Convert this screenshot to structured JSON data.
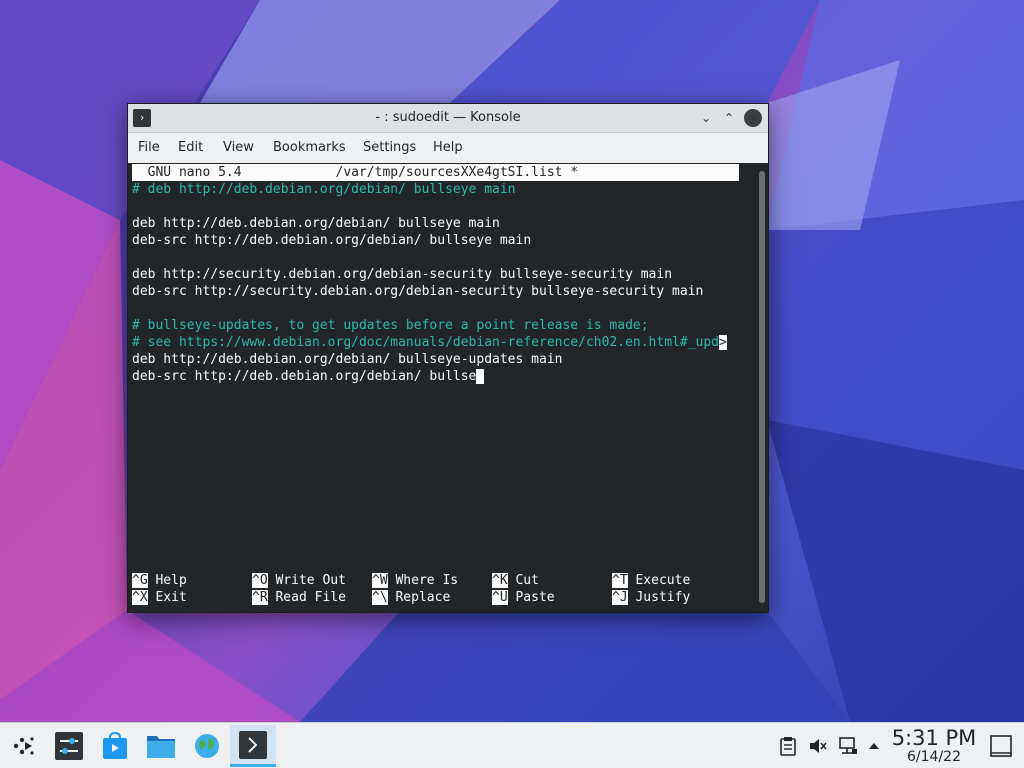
{
  "window": {
    "title": "- : sudoedit — Konsole",
    "minimize_glyph": "⌄",
    "maximize_glyph": "⌃",
    "close_glyph": "✕",
    "app_icon_glyph": "›"
  },
  "menubar": {
    "items": [
      "File",
      "Edit",
      "View",
      "Bookmarks",
      "Settings",
      "Help"
    ]
  },
  "nano": {
    "header": "  GNU nano 5.4            /var/tmp/sourcesXXe4gtSI.list *",
    "lines": [
      {
        "text": "# deb http://deb.debian.org/debian/ bullseye main",
        "kind": "comment"
      },
      {
        "text": "",
        "kind": "plain"
      },
      {
        "text": "deb http://deb.debian.org/debian/ bullseye main",
        "kind": "plain"
      },
      {
        "text": "deb-src http://deb.debian.org/debian/ bullseye main",
        "kind": "plain"
      },
      {
        "text": "",
        "kind": "plain"
      },
      {
        "text": "deb http://security.debian.org/debian-security bullseye-security main",
        "kind": "plain"
      },
      {
        "text": "deb-src http://security.debian.org/debian-security bullseye-security main",
        "kind": "plain"
      },
      {
        "text": "",
        "kind": "plain"
      },
      {
        "text": "# bullseye-updates, to get updates before a point release is made;",
        "kind": "comment"
      },
      {
        "text": "# see https://www.debian.org/doc/manuals/debian-reference/ch02.en.html#_upd",
        "kind": "comment",
        "overflow_marker": ">"
      },
      {
        "text": "deb http://deb.debian.org/debian/ bullseye-updates main",
        "kind": "plain"
      },
      {
        "text": "deb-src http://deb.debian.org/debian/ bullse",
        "kind": "plain",
        "cursor": true
      }
    ],
    "shortcuts_row1": [
      {
        "key": "^G",
        "label": "Help"
      },
      {
        "key": "^O",
        "label": "Write Out"
      },
      {
        "key": "^W",
        "label": "Where Is"
      },
      {
        "key": "^K",
        "label": "Cut"
      },
      {
        "key": "^T",
        "label": "Execute"
      }
    ],
    "shortcuts_row2": [
      {
        "key": "^X",
        "label": "Exit"
      },
      {
        "key": "^R",
        "label": "Read File"
      },
      {
        "key": "^\\",
        "label": "Replace"
      },
      {
        "key": "^U",
        "label": "Paste"
      },
      {
        "key": "^J",
        "label": "Justify"
      }
    ]
  },
  "taskbar": {
    "apps": [
      "application-launcher-icon",
      "system-settings-icon",
      "discover-store-icon",
      "dolphin-folder-icon",
      "web-browser-globe-icon",
      "konsole-terminal-icon"
    ],
    "tray": [
      "clipboard-icon",
      "volume-muted-icon",
      "network-wired-icon",
      "tray-expand-arrow-icon"
    ],
    "clock_time": "5:31 PM",
    "clock_date": "6/14/22",
    "show_desktop": "show-desktop-icon"
  },
  "colors": {
    "terminal_bg": "#232629",
    "comment": "#2bb8a6",
    "accent": "#3daee9"
  }
}
